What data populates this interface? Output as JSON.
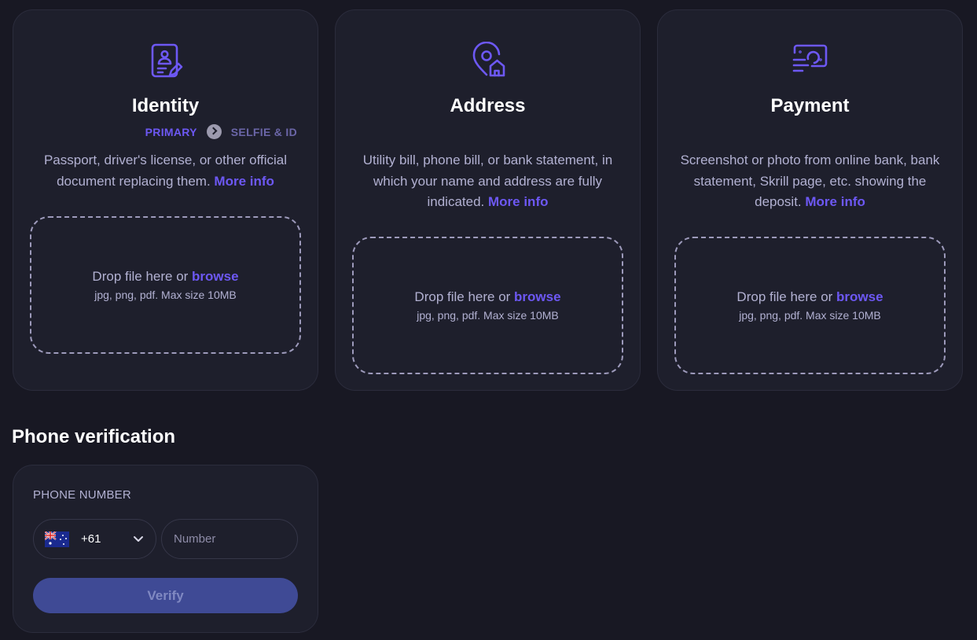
{
  "cards": [
    {
      "icon": "id-document-icon",
      "title": "Identity",
      "steps": {
        "primary": "PRIMARY",
        "secondary": "SELFIE & ID"
      },
      "description": "Passport, driver's license, or other official document replacing them.",
      "more_link": "More info",
      "drop_text": "Drop file here or",
      "browse_link": "browse",
      "drop_hint": "jpg, png, pdf. Max size 10MB"
    },
    {
      "icon": "location-home-icon",
      "title": "Address",
      "description": "Utility bill, phone bill, or bank statement, in which your name and address are fully indicated.",
      "more_link": "More info",
      "drop_text": "Drop file here or",
      "browse_link": "browse",
      "drop_hint": "jpg, png, pdf. Max size 10MB"
    },
    {
      "icon": "payment-banknote-icon",
      "title": "Payment",
      "description": "Screenshot or photo from online bank, bank statement, Skrill page, etc. showing the deposit.",
      "more_link": "More info",
      "drop_text": "Drop file here or",
      "browse_link": "browse",
      "drop_hint": "jpg, png, pdf. Max size 10MB"
    }
  ],
  "phone": {
    "heading": "Phone verification",
    "label": "PHONE NUMBER",
    "country_flag": "australia-flag-icon",
    "dial_code": "+61",
    "number_placeholder": "Number",
    "verify_label": "Verify"
  },
  "colors": {
    "background": "#181823",
    "card": "#1e1f2c",
    "accent": "#6d58f4",
    "text_muted": "#b2b1d2",
    "verify_button": "#3f4a95"
  }
}
